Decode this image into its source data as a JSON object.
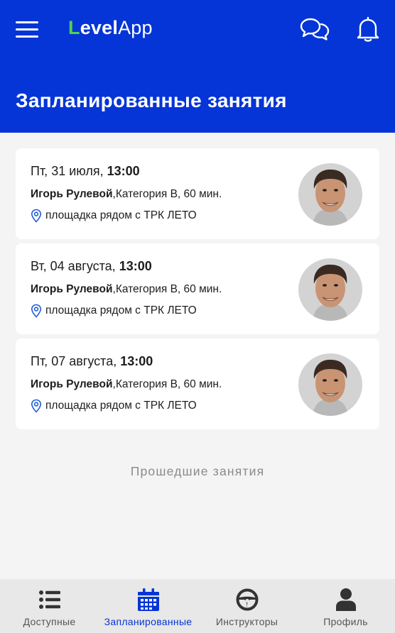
{
  "app": {
    "logo_first": "L",
    "logo_rest": "evel",
    "logo_app": "App"
  },
  "header": {
    "title": "Запланированные занятия",
    "icons": [
      "menu-icon",
      "chat-icon",
      "bell-icon"
    ]
  },
  "colors": {
    "brand_blue": "#0535d6",
    "logo_green": "#4fd44a",
    "background": "#f4f4f4",
    "tabbar": "#e8e8e8"
  },
  "lessons": [
    {
      "date": "Пт, 31 июля, ",
      "time": "13:00",
      "instructor": "Игорь Рулевой",
      "details": ",Категория B, 60 мин.",
      "place": "площадка рядом с ТРК ЛЕТО"
    },
    {
      "date": "Вт, 04 августа, ",
      "time": "13:00",
      "instructor": "Игорь Рулевой",
      "details": ",Категория B, 60 мин.",
      "place": "площадка рядом с ТРК ЛЕТО"
    },
    {
      "date": "Пт, 07 августа, ",
      "time": "13:00",
      "instructor": "Игорь Рулевой",
      "details": ",Категория B, 60 мин.",
      "place": "площадка рядом с ТРК ЛЕТО"
    }
  ],
  "past_link": "Прошедшие занятия",
  "tabs": [
    {
      "label": "Доступные",
      "icon": "list-icon",
      "active": false
    },
    {
      "label": "Запланированные",
      "icon": "calendar-icon",
      "active": true
    },
    {
      "label": "Инструкторы",
      "icon": "steering-wheel-icon",
      "active": false
    },
    {
      "label": "Профиль",
      "icon": "person-icon",
      "active": false
    }
  ]
}
